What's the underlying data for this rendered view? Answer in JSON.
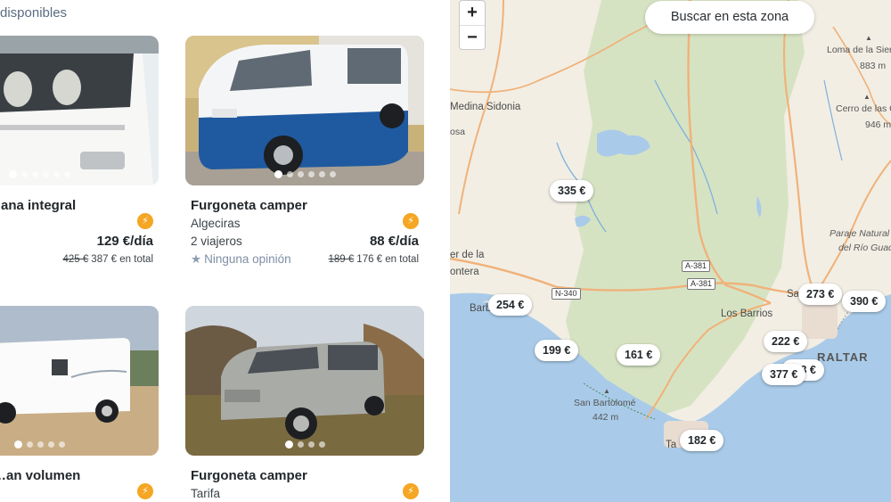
{
  "list": {
    "available_text": "disponibles",
    "cards": [
      {
        "title": "…ana integral",
        "city": "",
        "travellers": "",
        "price": "129 €/día",
        "price_old": "425 €",
        "price_total": "387 € en total",
        "reviews": "",
        "instant_icon": "lightning-icon",
        "dots": 6,
        "active_dot": 0
      },
      {
        "title": "Furgoneta camper",
        "city": "Algeciras",
        "travellers": "2 viajeros",
        "price": "88 €/día",
        "price_old": "189 €",
        "price_total": "176 € en total",
        "reviews": "Ninguna opinión",
        "instant_icon": "lightning-icon",
        "dots": 6,
        "active_dot": 0
      },
      {
        "title": "…an volumen",
        "city": "",
        "instant_icon": "lightning-icon",
        "dots": 5,
        "active_dot": 0
      },
      {
        "title": "Furgoneta camper",
        "city": "Tarifa",
        "instant_icon": "lightning-icon",
        "dots": 4,
        "active_dot": 0
      }
    ]
  },
  "map": {
    "zoom_in": "+",
    "zoom_out": "−",
    "search_zone": "Buscar en esta zona",
    "pins": [
      "335 €",
      "254 €",
      "199 €",
      "161 €",
      "273 €",
      "390 €",
      "222 €",
      "…3 €",
      "377 €",
      "182 €"
    ],
    "places": {
      "medina": "Medina Sidonia",
      "osa": "osa",
      "vejer1": "er de la",
      "vejer2": "ontera",
      "barbate": "Barb",
      "los_barrios": "Los Barrios",
      "san_roque": "Sa",
      "gibraltar": "RALTAR",
      "tarifa": "Ta",
      "loma": "Loma de la Sierra",
      "loma_alt": "883 m",
      "cerro": "Cerro de las C",
      "cerro_alt": "946 m",
      "paraje1": "Paraje Natural",
      "paraje2": "del Río Guadi",
      "sanbartolome": "San Bartolomé",
      "sanbartolome_alt": "442 m"
    },
    "roads": [
      "A-381",
      "A-381",
      "N-340"
    ],
    "colors": {
      "land": "#f2eee4",
      "park": "#d6e3c3",
      "water": "#a9cbe9",
      "road": "#f0b27a",
      "accent": "#f5a623"
    }
  }
}
